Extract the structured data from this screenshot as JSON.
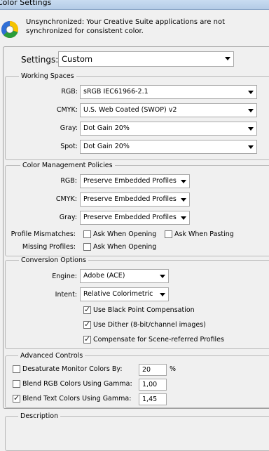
{
  "window": {
    "title": "Color Settings"
  },
  "info": {
    "icon": "color-wheel-icon",
    "message_line1": "Unsynchronized: Your Creative Suite applications are not",
    "message_line2": "synchronized for consistent color."
  },
  "settings": {
    "label": "Settings:",
    "value": "Custom"
  },
  "working_spaces": {
    "title": "Working Spaces",
    "rgb_label": "RGB:",
    "rgb_value": "sRGB IEC61966-2.1",
    "cmyk_label": "CMYK:",
    "cmyk_value": "U.S. Web Coated (SWOP) v2",
    "gray_label": "Gray:",
    "gray_value": "Dot Gain 20%",
    "spot_label": "Spot:",
    "spot_value": "Dot Gain 20%"
  },
  "policies": {
    "title": "Color Management Policies",
    "rgb_label": "RGB:",
    "rgb_value": "Preserve Embedded Profiles",
    "cmyk_label": "CMYK:",
    "cmyk_value": "Preserve Embedded Profiles",
    "gray_label": "Gray:",
    "gray_value": "Preserve Embedded Profiles",
    "mismatch_label": "Profile Mismatches:",
    "ask_opening_label": "Ask When Opening",
    "ask_pasting_label": "Ask When Pasting",
    "missing_label": "Missing Profiles:",
    "missing_ask_opening_label": "Ask When Opening",
    "ask_opening_checked": false,
    "ask_pasting_checked": false,
    "missing_ask_opening_checked": false
  },
  "conversion": {
    "title": "Conversion Options",
    "engine_label": "Engine:",
    "engine_value": "Adobe (ACE)",
    "intent_label": "Intent:",
    "intent_value": "Relative Colorimetric",
    "bpc_label": "Use Black Point Compensation",
    "bpc_checked": true,
    "dither_label": "Use Dither (8-bit/channel images)",
    "dither_checked": true,
    "compensate_label": "Compensate for Scene-referred Profiles",
    "compensate_checked": true
  },
  "advanced": {
    "title": "Advanced Controls",
    "desaturate_label": "Desaturate Monitor Colors By:",
    "desaturate_value": "20",
    "desaturate_unit": "%",
    "desaturate_checked": false,
    "blend_rgb_label": "Blend RGB Colors Using Gamma:",
    "blend_rgb_value": "1,00",
    "blend_rgb_checked": false,
    "blend_text_label": "Blend Text Colors Using Gamma:",
    "blend_text_value": "1,45",
    "blend_text_checked": true
  },
  "description": {
    "title": "Description"
  }
}
